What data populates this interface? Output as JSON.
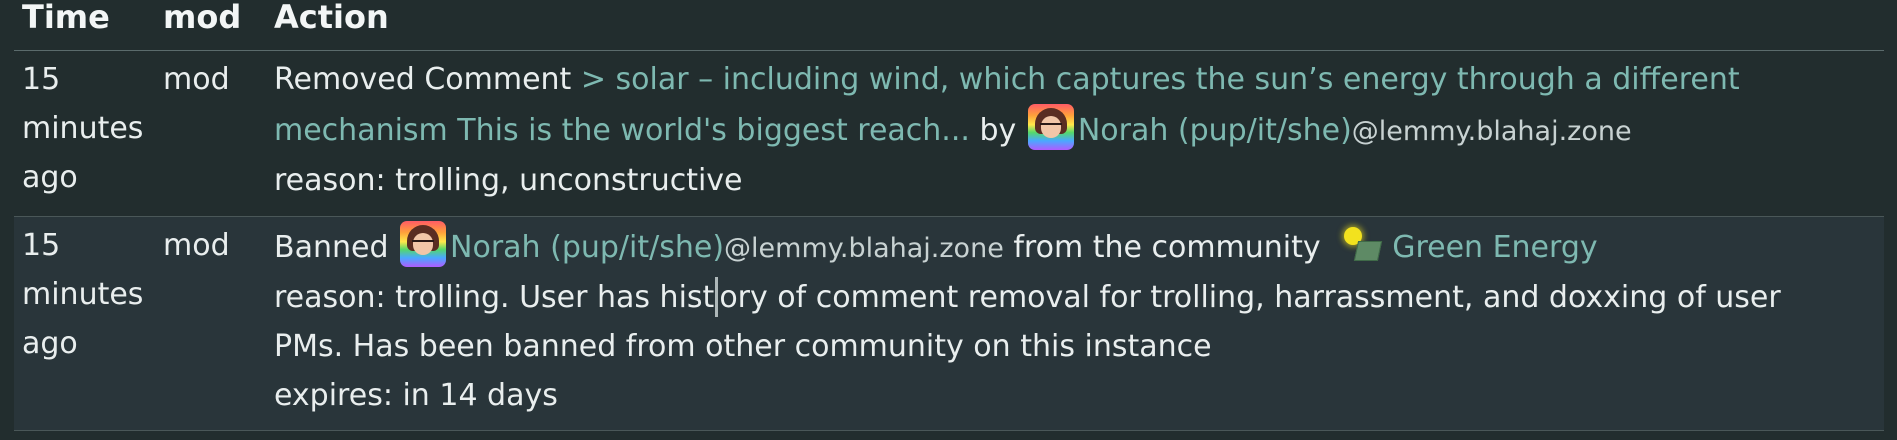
{
  "table": {
    "headers": {
      "time": "Time",
      "mod": "mod",
      "action": "Action"
    }
  },
  "rows": [
    {
      "time_line1": "15",
      "time_line2": "minutes",
      "time_line3": "ago",
      "mod": "mod",
      "action_prefix": "Removed Comment",
      "comment_preview_line1": "> solar – including wind, which captures the sun’s energy through a different",
      "comment_preview_line2": "mechanism This is the world's biggest reach...",
      "by_text": "by",
      "user_name": "Norah (pup/it/she)",
      "user_host": "@lemmy.blahaj.zone",
      "reason": "reason: trolling, unconstructive"
    },
    {
      "time_line1": "15",
      "time_line2": "minutes",
      "time_line3": "ago",
      "mod": "mod",
      "action_prefix": "Banned",
      "user_name": "Norah (pup/it/she)",
      "user_host": "@lemmy.blahaj.zone",
      "from_text": "from the community",
      "community_name": "Green Energy",
      "reason_part1": "reason: trolling. User has hist",
      "reason_part2": "ory of comment removal for trolling, harrassment, and doxxing of user",
      "reason_line2": "PMs. Has been banned from other community on this instance",
      "expires": "expires: in 14 days"
    }
  ],
  "icons": {
    "user_avatar": "user-avatar-icon",
    "community": "green-energy-community-icon"
  },
  "colors": {
    "background": "#222d2e",
    "row_alt_background": "#29353a",
    "link": "#7eb9b1",
    "text": "#e9eeee"
  }
}
